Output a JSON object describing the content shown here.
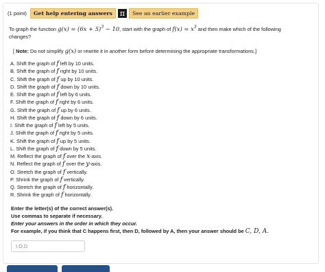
{
  "header": {
    "points": "(1 point)",
    "help_button": "Get help entering answers",
    "pi_icon_glyph": "π",
    "earlier_button": "See an earlier example"
  },
  "question": {
    "pre": "To graph the function",
    "func": "g(x) = (6x + 5)",
    "func_exp": "3",
    "func_tail": " − 10",
    "mid": ", start with the graph of",
    "base": "f(x) = x",
    "base_exp": "3",
    "post": " and then make which of the following",
    "line2": "changes?"
  },
  "note": {
    "open": "[ ",
    "label": "Note:",
    "pre": " Do not simplify ",
    "expr": "g(x)",
    "post": " or rewrite it in another form before determining the appropriate transformations.]"
  },
  "f_symbol": "f",
  "options": [
    {
      "pre": "A. Shift the graph of ",
      "post": " left by 10 units."
    },
    {
      "pre": "B. Shift the graph of ",
      "post": " right by 10 units."
    },
    {
      "pre": "C. Shift the graph of ",
      "post": " up by 10 units."
    },
    {
      "pre": "D. Shift the graph of ",
      "post": " down by 10 units."
    },
    {
      "pre": "E. Shift the graph of ",
      "post": " left by 6 units."
    },
    {
      "pre": "F. Shift the graph of ",
      "post": " right by 6 units."
    },
    {
      "pre": "G. Shift the graph of ",
      "post": " up by 6 units."
    },
    {
      "pre": "H. Shift the graph of ",
      "post": " down by 6 units."
    },
    {
      "pre": "I. Shift the graph of ",
      "post": " left by 5 units."
    },
    {
      "pre": "J. Shift the graph of ",
      "post": " right by 5 units."
    },
    {
      "pre": "K. Shift the graph of ",
      "post": " up by 5 units."
    },
    {
      "pre": "L. Shift the graph of ",
      "post": " down by 5 units."
    },
    {
      "pre": "M. Reflect the graph of ",
      "post": " over the ",
      "axis": "x",
      "tail": "-axis."
    },
    {
      "pre": "N. Reflect the graph of ",
      "post": " over the ",
      "axis": "y",
      "tail": "-axis."
    },
    {
      "pre": "O. Stretch the graph of ",
      "post": " vertically."
    },
    {
      "pre": "P. Shrink the graph of ",
      "post": " vertically."
    },
    {
      "pre": "Q. Stretch the graph of ",
      "post": " horizontally."
    },
    {
      "pre": "R. Shrink the graph of ",
      "post": " horizontally."
    }
  ],
  "instructions": {
    "line1": "Enter the letter(s) of the correct answer(s).",
    "line2": "Use commas to separate if necessary.",
    "line3": "Enter your answers in the order in which they occur.",
    "line4": "For example, if you think that C happens first, then D, followed by A, then your answer should be",
    "example": "C, D, A."
  },
  "answer_field": {
    "value": "",
    "placeholder": "I,O,D"
  },
  "colors": {
    "button_fill": "#f5cf86",
    "submit_blue": "#25508a"
  }
}
